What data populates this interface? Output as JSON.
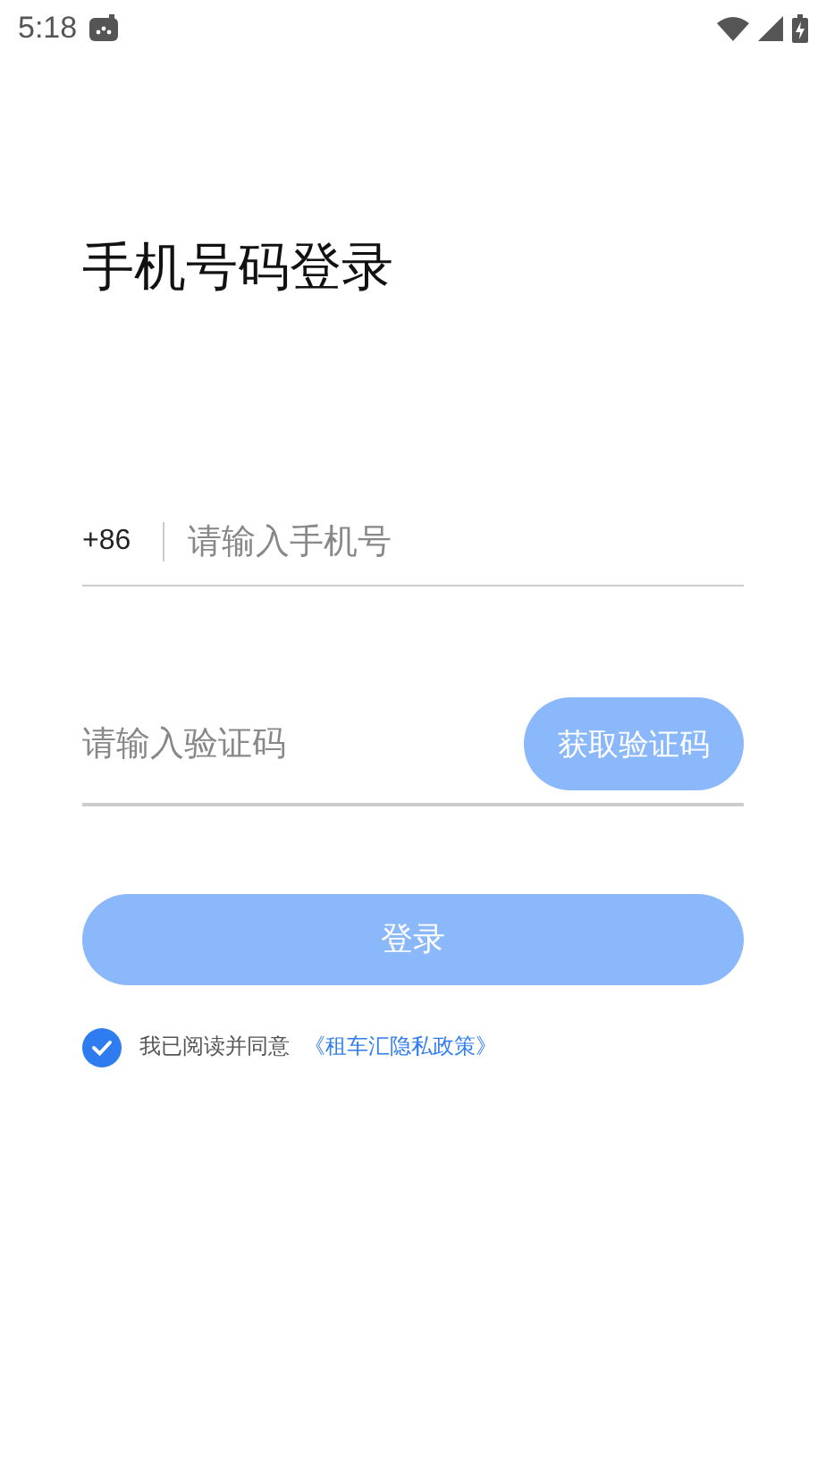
{
  "status_bar": {
    "time": "5:18"
  },
  "title": "手机号码登录",
  "phone_field": {
    "country_code": "+86",
    "placeholder": "请输入手机号"
  },
  "code_field": {
    "placeholder": "请输入验证码"
  },
  "get_code_button": {
    "label": "获取验证码",
    "disabled": true
  },
  "login_button": {
    "label": "登录",
    "disabled": true
  },
  "agreement": {
    "checked": true,
    "text": "我已阅读并同意",
    "link": "《租车汇隐私政策》"
  }
}
